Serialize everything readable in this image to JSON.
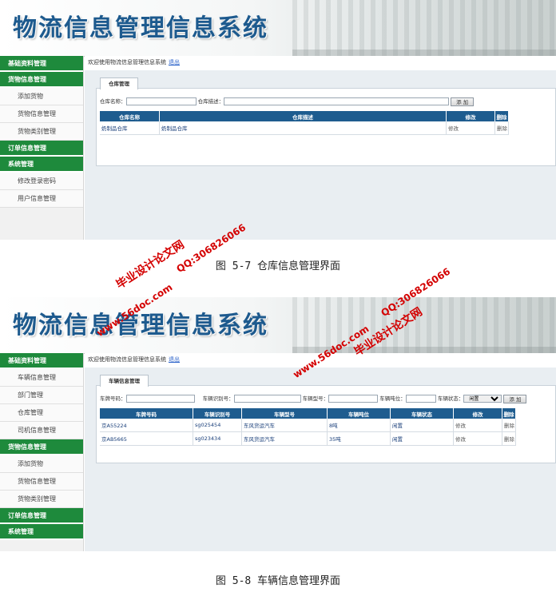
{
  "figure1": {
    "app_title": "物流信息管理信息系统",
    "welcome": "欢迎使用物流信息管理信息系统",
    "logout": "退出",
    "sidebar": [
      {
        "type": "header",
        "label": "基础资料管理"
      },
      {
        "type": "header",
        "label": "货物信息管理"
      },
      {
        "type": "item",
        "label": "添加货物"
      },
      {
        "type": "item",
        "label": "货物信息管理"
      },
      {
        "type": "item",
        "label": "货物类别管理"
      },
      {
        "type": "header",
        "label": "订单信息管理"
      },
      {
        "type": "header",
        "label": "系统管理"
      },
      {
        "type": "item",
        "label": "修改登录密码"
      },
      {
        "type": "item",
        "label": "用户信息管理"
      }
    ],
    "tab": "仓库管理",
    "filter": {
      "name_label": "仓库名称：",
      "desc_label": "仓库描述：",
      "add_button": "添 加"
    },
    "table": {
      "headers": [
        "仓库名称",
        "仓库描述",
        "修改",
        "删除"
      ],
      "rows": [
        [
          "奶制品仓库",
          "奶制品仓库",
          "修改",
          "删除"
        ]
      ]
    },
    "caption": "图 5-7 仓库信息管理界面"
  },
  "figure2": {
    "app_title": "物流信息管理信息系统",
    "welcome": "欢迎使用物流信息管理信息系统",
    "logout": "退出",
    "sidebar": [
      {
        "type": "header",
        "label": "基础资料管理"
      },
      {
        "type": "item",
        "label": "车辆信息管理"
      },
      {
        "type": "item",
        "label": "部门管理"
      },
      {
        "type": "item",
        "label": "仓库管理"
      },
      {
        "type": "item",
        "label": "司机信息管理"
      },
      {
        "type": "header",
        "label": "货物信息管理"
      },
      {
        "type": "item",
        "label": "添加货物"
      },
      {
        "type": "item",
        "label": "货物信息管理"
      },
      {
        "type": "item",
        "label": "货物类别管理"
      },
      {
        "type": "header",
        "label": "订单信息管理"
      },
      {
        "type": "header",
        "label": "系统管理"
      }
    ],
    "tab": "车辆信息管理",
    "filter": {
      "plate_label": "车牌号码：",
      "id_label": "车辆识别号：",
      "model_label": "车辆型号：",
      "tonnage_label": "车辆吨位：",
      "status_label": "车辆状态：",
      "status_value": "闲置",
      "add_button": "添 加"
    },
    "table": {
      "headers": [
        "车牌号码",
        "车辆识别号",
        "车辆型号",
        "车辆吨位",
        "车辆状态",
        "修改",
        "删除"
      ],
      "rows": [
        [
          "京A55224",
          "sg025454",
          "东风货运汽车",
          "8吨",
          "闲置",
          "修改",
          "删除"
        ],
        [
          "京AB5665",
          "sg023434",
          "东风货运汽车",
          "35吨",
          "闲置",
          "修改",
          "删除"
        ]
      ]
    },
    "caption": "图 5-8 车辆信息管理界面"
  },
  "watermarks": [
    "www.56doc.com",
    "QQ:306826066",
    "毕业设计论文网"
  ]
}
